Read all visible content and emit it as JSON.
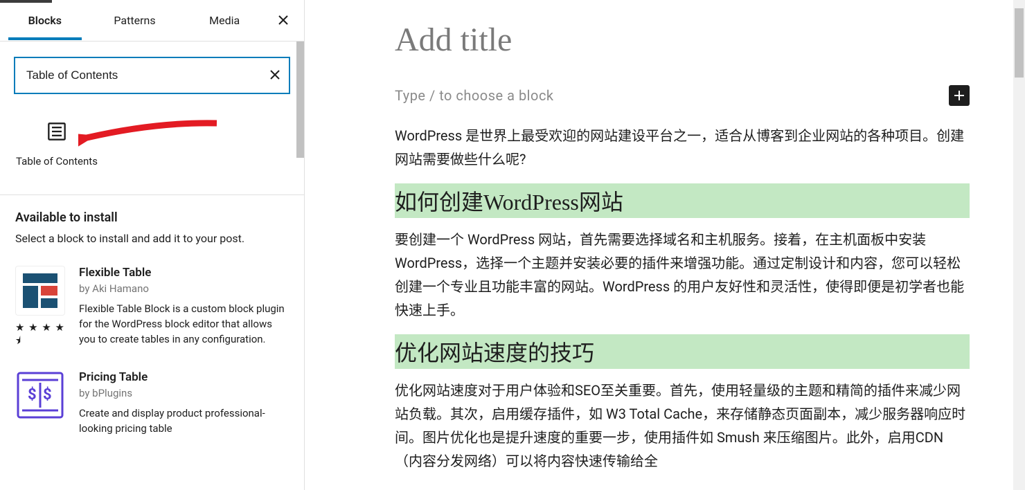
{
  "tabs": {
    "blocks": "Blocks",
    "patterns": "Patterns",
    "media": "Media"
  },
  "search": {
    "value": "Table of Contents"
  },
  "block_result": {
    "label": "Table of Contents"
  },
  "install": {
    "heading": "Available to install",
    "sub": "Select a block to install and add it to your post."
  },
  "plugins": [
    {
      "title": "Flexible Table",
      "author": "by Aki Hamano",
      "desc": "Flexible Table Block is a custom block plugin for the WordPress block editor that allows you to create tables in any configuration.",
      "stars": "★ ★ ★ ★ ⯨"
    },
    {
      "title": "Pricing Table",
      "author": "by bPlugins",
      "desc": "Create and display product professional-looking pricing table",
      "stars": ""
    }
  ],
  "editor": {
    "title_placeholder": "Add title",
    "prompt": "Type / to choose a block",
    "p1": "WordPress 是世界上最受欢迎的网站建设平台之一，适合从博客到企业网站的各种项目。创建网站需要做些什么呢?",
    "h2a": "如何创建WordPress网站",
    "p2": "要创建一个 WordPress 网站，首先需要选择域名和主机服务。接着，在主机面板中安装 WordPress，选择一个主题并安装必要的插件来增强功能。通过定制设计和内容，您可以轻松创建一个专业且功能丰富的网站。WordPress 的用户友好性和灵活性，使得即便是初学者也能快速上手。",
    "h2b": "优化网站速度的技巧",
    "p3": "优化网站速度对于用户体验和SEO至关重要。首先，使用轻量级的主题和精简的插件来减少网站负载。其次，启用缓存插件，如 W3 Total Cache，来存储静态页面副本，减少服务器响应时间。图片优化也是提升速度的重要一步，使用插件如 Smush 来压缩图片。此外，启用CDN（内容分发网络）可以将内容快速传输给全"
  }
}
